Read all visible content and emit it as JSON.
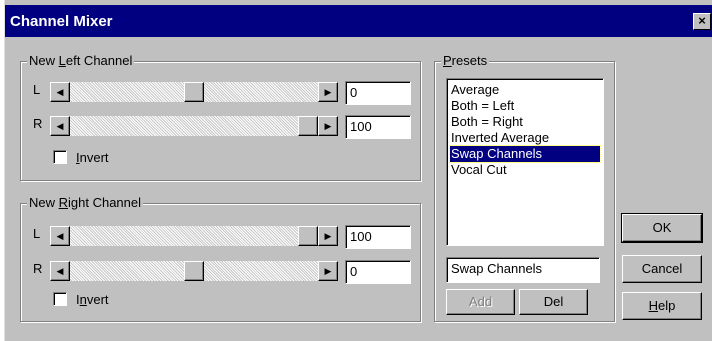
{
  "dialog": {
    "title": "Channel Mixer",
    "close_glyph": "×"
  },
  "left_channel": {
    "title_before": "New ",
    "title_accel": "L",
    "title_after": "eft Channel",
    "rows": [
      {
        "label": "L",
        "value": "0",
        "slider_fraction": 0.5
      },
      {
        "label": "R",
        "value": "100",
        "slider_fraction": 1.0
      }
    ],
    "invert_accel": "I",
    "invert_rest": "nvert",
    "invert_checked": false
  },
  "right_channel": {
    "title_before": "New ",
    "title_accel": "R",
    "title_after": "ight Channel",
    "rows": [
      {
        "label": "L",
        "value": "100",
        "slider_fraction": 1.0
      },
      {
        "label": "R",
        "value": "0",
        "slider_fraction": 0.5
      }
    ],
    "invert_before": "I",
    "invert_accel": "n",
    "invert_rest": "vert",
    "invert_checked": false
  },
  "presets": {
    "title_accel": "P",
    "title_rest": "resets",
    "items": [
      "Average",
      "Both = Left",
      "Both = Right",
      "Inverted Average",
      "Swap Channels",
      "Vocal Cut"
    ],
    "selected": "Swap Channels",
    "name_value": "Swap Channels",
    "add_label": "Add",
    "del_label": "Del"
  },
  "buttons": {
    "ok": "OK",
    "cancel": "Cancel",
    "help_accel": "H",
    "help_rest": "elp"
  },
  "icons": {
    "left_arrow": "◀",
    "right_arrow": "▶"
  }
}
